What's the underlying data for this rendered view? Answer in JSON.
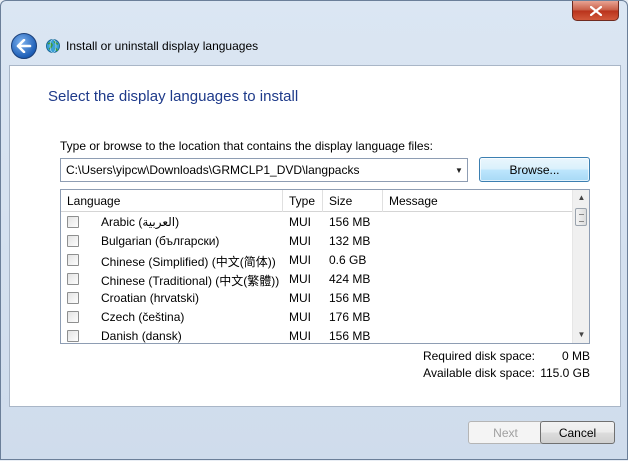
{
  "window": {
    "title": "Install or uninstall display languages"
  },
  "page": {
    "heading": "Select the display languages to install",
    "prompt": "Type or browse to the location that contains the display language files:",
    "path_value": "C:\\Users\\yipcw\\Downloads\\GRMCLP1_DVD\\langpacks",
    "browse_label": "Browse..."
  },
  "list": {
    "columns": [
      "Language",
      "Type",
      "Size",
      "Message"
    ],
    "rows": [
      {
        "language": "Arabic (العربية)",
        "type": "MUI",
        "size": "156 MB",
        "message": ""
      },
      {
        "language": "Bulgarian (български)",
        "type": "MUI",
        "size": "132 MB",
        "message": ""
      },
      {
        "language": "Chinese (Simplified) (中文(简体))",
        "type": "MUI",
        "size": "0.6 GB",
        "message": ""
      },
      {
        "language": "Chinese (Traditional) (中文(繁體))",
        "type": "MUI",
        "size": "424 MB",
        "message": ""
      },
      {
        "language": "Croatian (hrvatski)",
        "type": "MUI",
        "size": "156 MB",
        "message": ""
      },
      {
        "language": "Czech (čeština)",
        "type": "MUI",
        "size": "176 MB",
        "message": ""
      },
      {
        "language": "Danish (dansk)",
        "type": "MUI",
        "size": "156 MB",
        "message": ""
      }
    ]
  },
  "disk": {
    "required_label": "Required disk space:",
    "required_value": "0 MB",
    "available_label": "Available disk space:",
    "available_value": "115.0 GB"
  },
  "footer": {
    "next_label": "Next",
    "cancel_label": "Cancel"
  },
  "colors": {
    "heading": "#1e3a8a",
    "close_button": "#c75a43"
  }
}
